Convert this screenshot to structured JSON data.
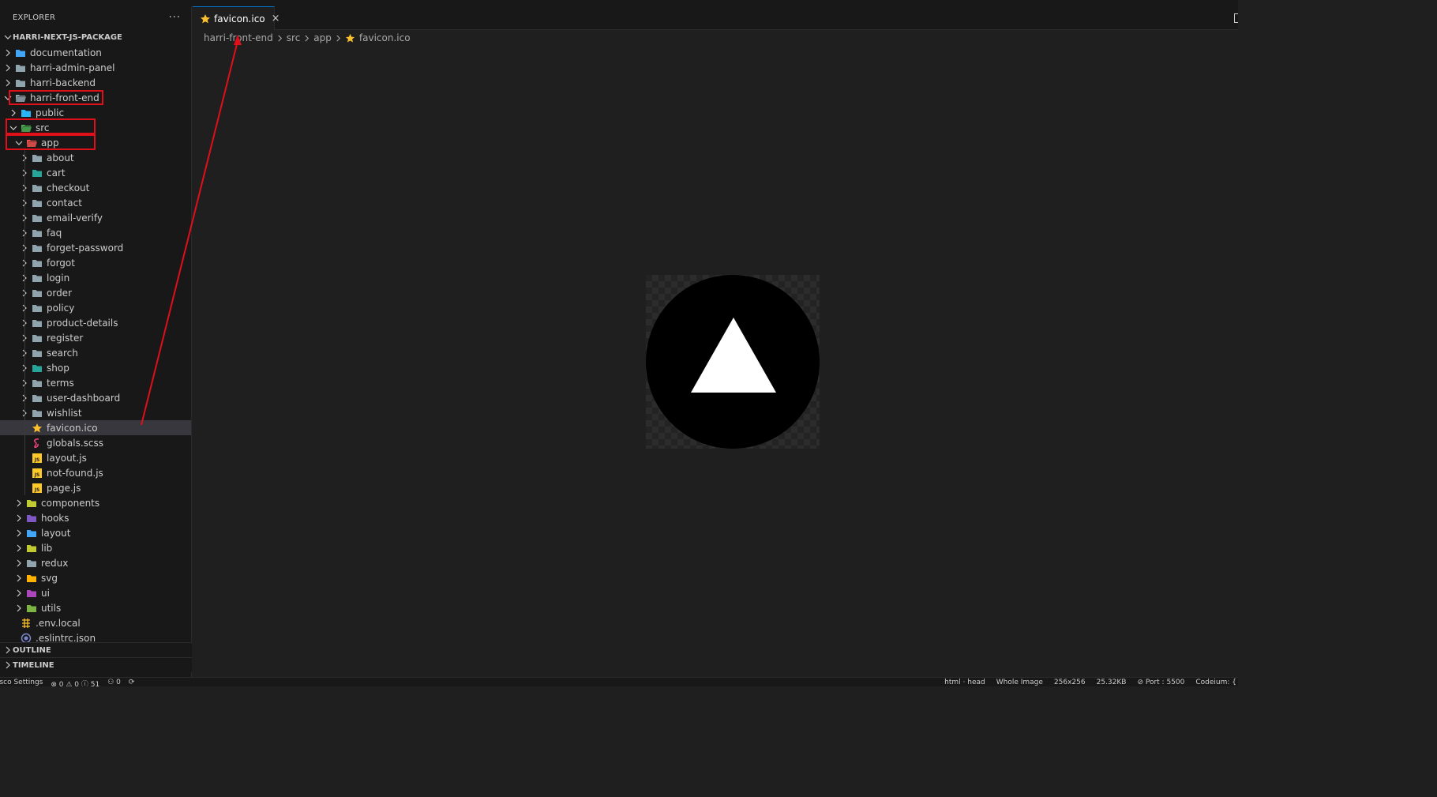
{
  "sidebar": {
    "title": "EXPLORER",
    "more_label": "···",
    "root_label": "HARRI-NEXT-JS-PACKAGE",
    "items": [
      {
        "label": "documentation",
        "depth": 0,
        "kind": "folder",
        "expanded": false,
        "icon": "folder-docs-icon",
        "color": "#42a5f5"
      },
      {
        "label": "harri-admin-panel",
        "depth": 0,
        "kind": "folder",
        "expanded": false,
        "icon": "folder-icon",
        "color": "#90a4ae"
      },
      {
        "label": "harri-backend",
        "depth": 0,
        "kind": "folder",
        "expanded": false,
        "icon": "folder-icon",
        "color": "#90a4ae"
      },
      {
        "label": "harri-front-end",
        "depth": 0,
        "kind": "folder",
        "expanded": true,
        "icon": "folder-open-icon",
        "color": "#90a4ae"
      },
      {
        "label": "public",
        "depth": 1,
        "kind": "folder",
        "expanded": false,
        "icon": "folder-public-icon",
        "color": "#29b6f6"
      },
      {
        "label": "src",
        "depth": 1,
        "kind": "folder",
        "expanded": true,
        "icon": "folder-src-icon",
        "color": "#4caf50"
      },
      {
        "label": "app",
        "depth": 2,
        "kind": "folder",
        "expanded": true,
        "icon": "folder-app-icon",
        "color": "#ef5350"
      },
      {
        "label": "about",
        "depth": 3,
        "kind": "folder",
        "expanded": false,
        "icon": "folder-icon",
        "color": "#90a4ae"
      },
      {
        "label": "cart",
        "depth": 3,
        "kind": "folder",
        "expanded": false,
        "icon": "folder-cart-icon",
        "color": "#26a69a"
      },
      {
        "label": "checkout",
        "depth": 3,
        "kind": "folder",
        "expanded": false,
        "icon": "folder-icon",
        "color": "#90a4ae"
      },
      {
        "label": "contact",
        "depth": 3,
        "kind": "folder",
        "expanded": false,
        "icon": "folder-icon",
        "color": "#90a4ae"
      },
      {
        "label": "email-verify",
        "depth": 3,
        "kind": "folder",
        "expanded": false,
        "icon": "folder-icon",
        "color": "#90a4ae"
      },
      {
        "label": "faq",
        "depth": 3,
        "kind": "folder",
        "expanded": false,
        "icon": "folder-icon",
        "color": "#90a4ae"
      },
      {
        "label": "forget-password",
        "depth": 3,
        "kind": "folder",
        "expanded": false,
        "icon": "folder-icon",
        "color": "#90a4ae"
      },
      {
        "label": "forgot",
        "depth": 3,
        "kind": "folder",
        "expanded": false,
        "icon": "folder-icon",
        "color": "#90a4ae"
      },
      {
        "label": "login",
        "depth": 3,
        "kind": "folder",
        "expanded": false,
        "icon": "folder-icon",
        "color": "#90a4ae"
      },
      {
        "label": "order",
        "depth": 3,
        "kind": "folder",
        "expanded": false,
        "icon": "folder-icon",
        "color": "#90a4ae"
      },
      {
        "label": "policy",
        "depth": 3,
        "kind": "folder",
        "expanded": false,
        "icon": "folder-icon",
        "color": "#90a4ae"
      },
      {
        "label": "product-details",
        "depth": 3,
        "kind": "folder",
        "expanded": false,
        "icon": "folder-icon",
        "color": "#90a4ae"
      },
      {
        "label": "register",
        "depth": 3,
        "kind": "folder",
        "expanded": false,
        "icon": "folder-icon",
        "color": "#90a4ae"
      },
      {
        "label": "search",
        "depth": 3,
        "kind": "folder",
        "expanded": false,
        "icon": "folder-icon",
        "color": "#90a4ae"
      },
      {
        "label": "shop",
        "depth": 3,
        "kind": "folder",
        "expanded": false,
        "icon": "folder-shop-icon",
        "color": "#26a69a"
      },
      {
        "label": "terms",
        "depth": 3,
        "kind": "folder",
        "expanded": false,
        "icon": "folder-icon",
        "color": "#90a4ae"
      },
      {
        "label": "user-dashboard",
        "depth": 3,
        "kind": "folder",
        "expanded": false,
        "icon": "folder-icon",
        "color": "#90a4ae"
      },
      {
        "label": "wishlist",
        "depth": 3,
        "kind": "folder",
        "expanded": false,
        "icon": "folder-icon",
        "color": "#90a4ae"
      },
      {
        "label": "favicon.ico",
        "depth": 3,
        "kind": "file",
        "icon": "star-icon",
        "color": "#fbc02d",
        "selected": true
      },
      {
        "label": "globals.scss",
        "depth": 3,
        "kind": "file",
        "icon": "sass-icon",
        "color": "#ec407a"
      },
      {
        "label": "layout.js",
        "depth": 3,
        "kind": "file",
        "icon": "javascript-icon",
        "color": "#ffca28"
      },
      {
        "label": "not-found.js",
        "depth": 3,
        "kind": "file",
        "icon": "javascript-icon",
        "color": "#ffca28"
      },
      {
        "label": "page.js",
        "depth": 3,
        "kind": "file",
        "icon": "javascript-icon",
        "color": "#ffca28"
      },
      {
        "label": "components",
        "depth": 2,
        "kind": "folder",
        "expanded": false,
        "icon": "folder-components-icon",
        "color": "#c0ca33"
      },
      {
        "label": "hooks",
        "depth": 2,
        "kind": "folder",
        "expanded": false,
        "icon": "folder-hooks-icon",
        "color": "#7e57c2"
      },
      {
        "label": "layout",
        "depth": 2,
        "kind": "folder",
        "expanded": false,
        "icon": "folder-layout-icon",
        "color": "#42a5f5"
      },
      {
        "label": "lib",
        "depth": 2,
        "kind": "folder",
        "expanded": false,
        "icon": "folder-lib-icon",
        "color": "#c0ca33"
      },
      {
        "label": "redux",
        "depth": 2,
        "kind": "folder",
        "expanded": false,
        "icon": "folder-icon",
        "color": "#90a4ae"
      },
      {
        "label": "svg",
        "depth": 2,
        "kind": "folder",
        "expanded": false,
        "icon": "folder-svg-icon",
        "color": "#ffb300"
      },
      {
        "label": "ui",
        "depth": 2,
        "kind": "folder",
        "expanded": false,
        "icon": "folder-ui-icon",
        "color": "#ab47bc"
      },
      {
        "label": "utils",
        "depth": 2,
        "kind": "folder",
        "expanded": false,
        "icon": "folder-utils-icon",
        "color": "#7cb342"
      },
      {
        "label": ".env.local",
        "depth": 1,
        "kind": "file",
        "icon": "env-icon",
        "color": "#fbc02d"
      },
      {
        "label": ".eslintrc.json",
        "depth": 1,
        "kind": "file",
        "icon": "eslint-icon",
        "color": "#7986cb"
      },
      {
        "label": "",
        "depth": 1,
        "kind": "file",
        "icon": "file-icon",
        "color": "#ef5350"
      }
    ],
    "outline_label": "OUTLINE",
    "timeline_label": "TIMELINE"
  },
  "editor": {
    "tab": {
      "label": "favicon.ico",
      "close_icon": "×",
      "icon": "star-icon"
    },
    "breadcrumb": [
      "harri-front-end",
      "src",
      "app",
      "favicon.ico"
    ],
    "image": {
      "description_icon": "vercel-triangle-icon",
      "background": "#000000",
      "foreground": "#ffffff"
    }
  },
  "statusbar": {
    "left": [
      "cisco Settings",
      "⊗ 0 ⚠ 0 ⓘ 51",
      "⚇ 0",
      "⟳"
    ],
    "right": [
      "html · head",
      "Whole Image",
      "256x256",
      "25.32KB",
      "⊘ Port : 5500",
      "Codeium: {"
    ]
  },
  "colors": {
    "accent": "#0078d4",
    "annotation": "#e0101a",
    "sidebar_bg": "#181818",
    "editor_bg": "#1f1f1f"
  }
}
